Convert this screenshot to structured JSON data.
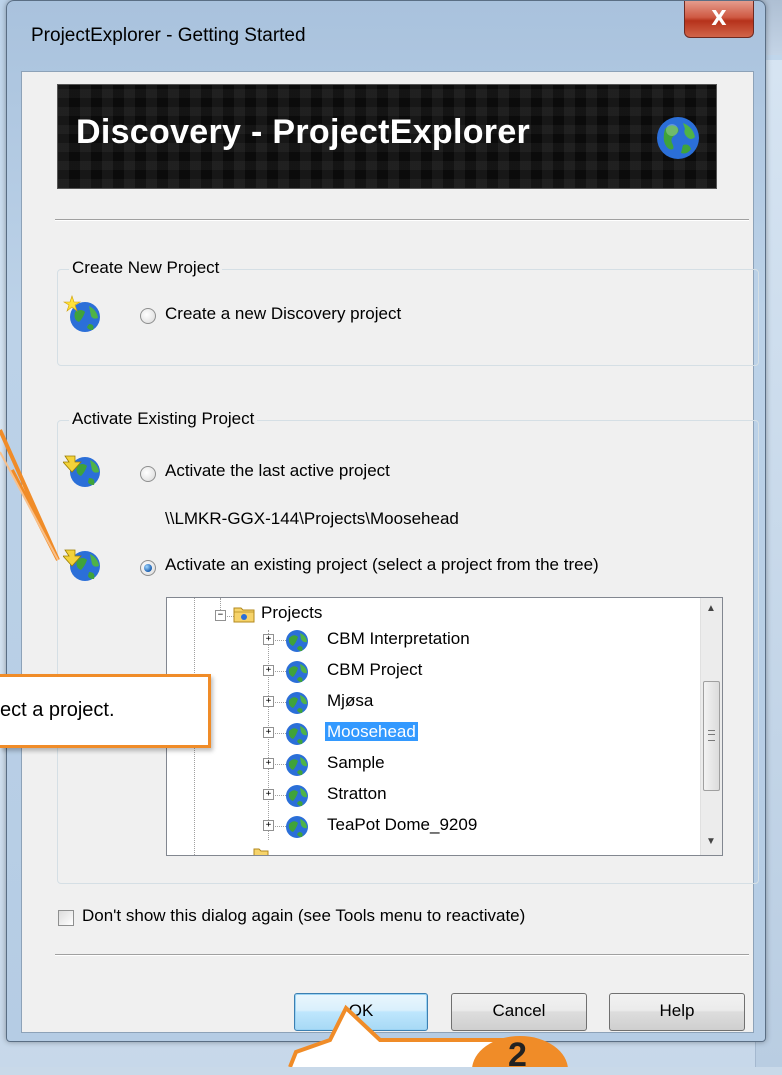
{
  "window": {
    "title": "ProjectExplorer - Getting Started",
    "close_label": "X"
  },
  "banner": {
    "text": "Discovery - ProjectExplorer"
  },
  "create_group": {
    "label": "Create New Project",
    "option_label": "Create a new Discovery project",
    "selected": false
  },
  "activate_group": {
    "label": "Activate Existing Project",
    "last_active_label": "Activate the last active project",
    "last_active_selected": false,
    "last_active_path": "\\\\LMKR-GGX-144\\Projects\\Moosehead",
    "existing_label": "Activate an existing project (select a project from the tree)",
    "existing_selected": true
  },
  "tree": {
    "root": {
      "label": "Projects",
      "expander": "−",
      "icon": "folder-icon"
    },
    "items": [
      {
        "label": "CBM Interpretation",
        "expander": "+",
        "icon": "globe-icon",
        "selected": false
      },
      {
        "label": "CBM Project",
        "expander": "+",
        "icon": "globe-icon",
        "selected": false
      },
      {
        "label": "Mjøsa",
        "expander": "+",
        "icon": "globe-icon",
        "selected": false
      },
      {
        "label": "Moosehead",
        "expander": "+",
        "icon": "globe-icon",
        "selected": true
      },
      {
        "label": "Sample",
        "expander": "+",
        "icon": "globe-icon",
        "selected": false
      },
      {
        "label": "Stratton",
        "expander": "+",
        "icon": "globe-icon",
        "selected": false
      },
      {
        "label": "TeaPot Dome_9209",
        "expander": "+",
        "icon": "globe-icon",
        "selected": false
      }
    ],
    "scroll_up": "▲",
    "scroll_down": "▼"
  },
  "dont_show": {
    "label": "Don't show this dialog again (see Tools menu to reactivate)",
    "checked": false
  },
  "buttons": {
    "ok": "OK",
    "cancel": "Cancel",
    "help": "Help"
  },
  "callouts": {
    "select_project": "ect a project.",
    "step_number": "2"
  },
  "colors": {
    "accent_orange": "#f08c28",
    "selection_blue": "#3399ff",
    "close_red": "#c8452d"
  }
}
